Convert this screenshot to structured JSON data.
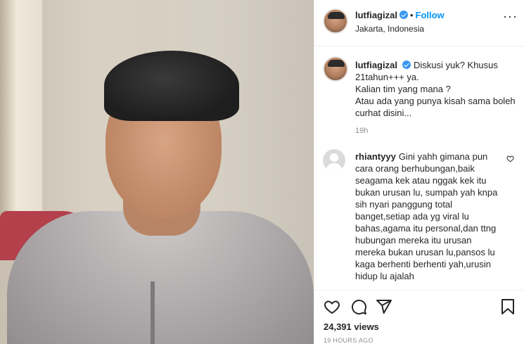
{
  "post": {
    "username": "lutfiagizal",
    "follow_label": "Follow",
    "separator": "•",
    "location": "Jakarta, Indonesia",
    "more_glyph": "···"
  },
  "caption": {
    "username": "lutfiagizal",
    "text": "Diskusi yuk? Khusus 21tahun+++ ya.\nKalian tim yang mana ?\nAtau ada yang punya kisah sama boleh curhat disini...",
    "time": "19h"
  },
  "comment": {
    "username": "rhiantyyy",
    "text": "Gini yahh gimana pun cara orang berhubungan,baik seagama kek atau nggak kek itu bukan urusan lu, sumpah yah knpa sih nyari panggung total banget,setiap ada yg viral lu bahas,agama itu personal,dan ttng hubungan mereka itu urusan mereka bukan urusan lu,pansos lu kaga berhenti berhenti yah,urusin hidup lu ajalah"
  },
  "actions": {
    "like_icon": "heart-icon",
    "comment_icon": "comment-icon",
    "share_icon": "share-icon",
    "save_icon": "bookmark-icon"
  },
  "stats": {
    "views": "24,391 views",
    "posted": "19 HOURS AGO"
  },
  "colors": {
    "accent": "#0095f6",
    "verified": "#3897f0",
    "muted": "#8e8e8e",
    "border": "#efefef"
  }
}
